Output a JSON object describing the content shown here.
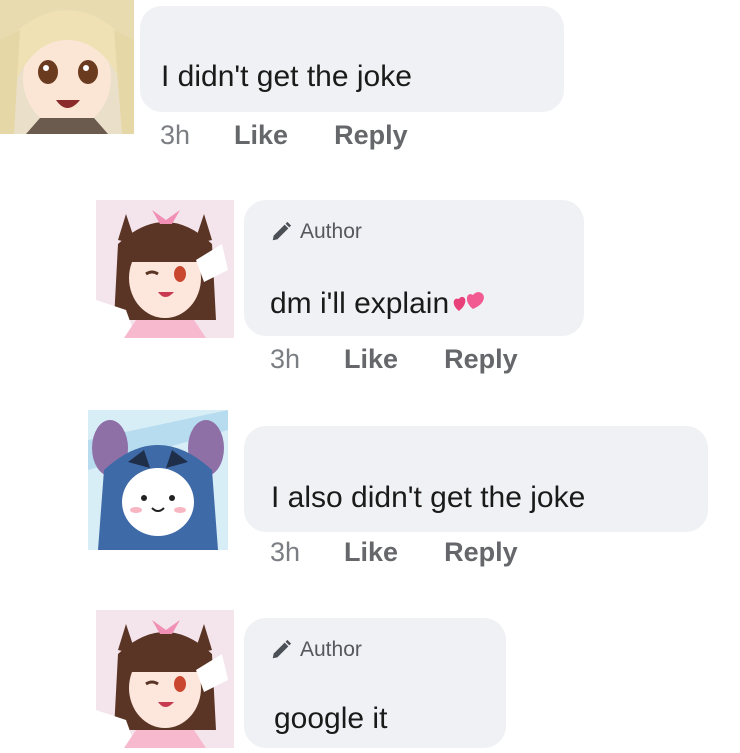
{
  "comments": [
    {
      "avatar": "blonde-anime-girl-avatar",
      "author_tag": "",
      "text": "I didn't get the joke",
      "time": "3h",
      "like_label": "Like",
      "reply_label": "Reply"
    },
    {
      "avatar": "catgirl-anime-avatar",
      "author_tag": "Author",
      "text": "dm i'll explain",
      "emoji": "two-hearts-icon",
      "time": "3h",
      "like_label": "Like",
      "reply_label": "Reply"
    },
    {
      "avatar": "stitch-costume-character-avatar",
      "author_tag": "",
      "text": "I also didn't get the joke",
      "time": "3h",
      "like_label": "Like",
      "reply_label": "Reply"
    },
    {
      "avatar": "catgirl-anime-avatar",
      "author_tag": "Author",
      "text": "google it"
    }
  ],
  "colors": {
    "bubble": "#f0f1f4",
    "meta_text": "#65676b",
    "heart": "#e8417a"
  }
}
